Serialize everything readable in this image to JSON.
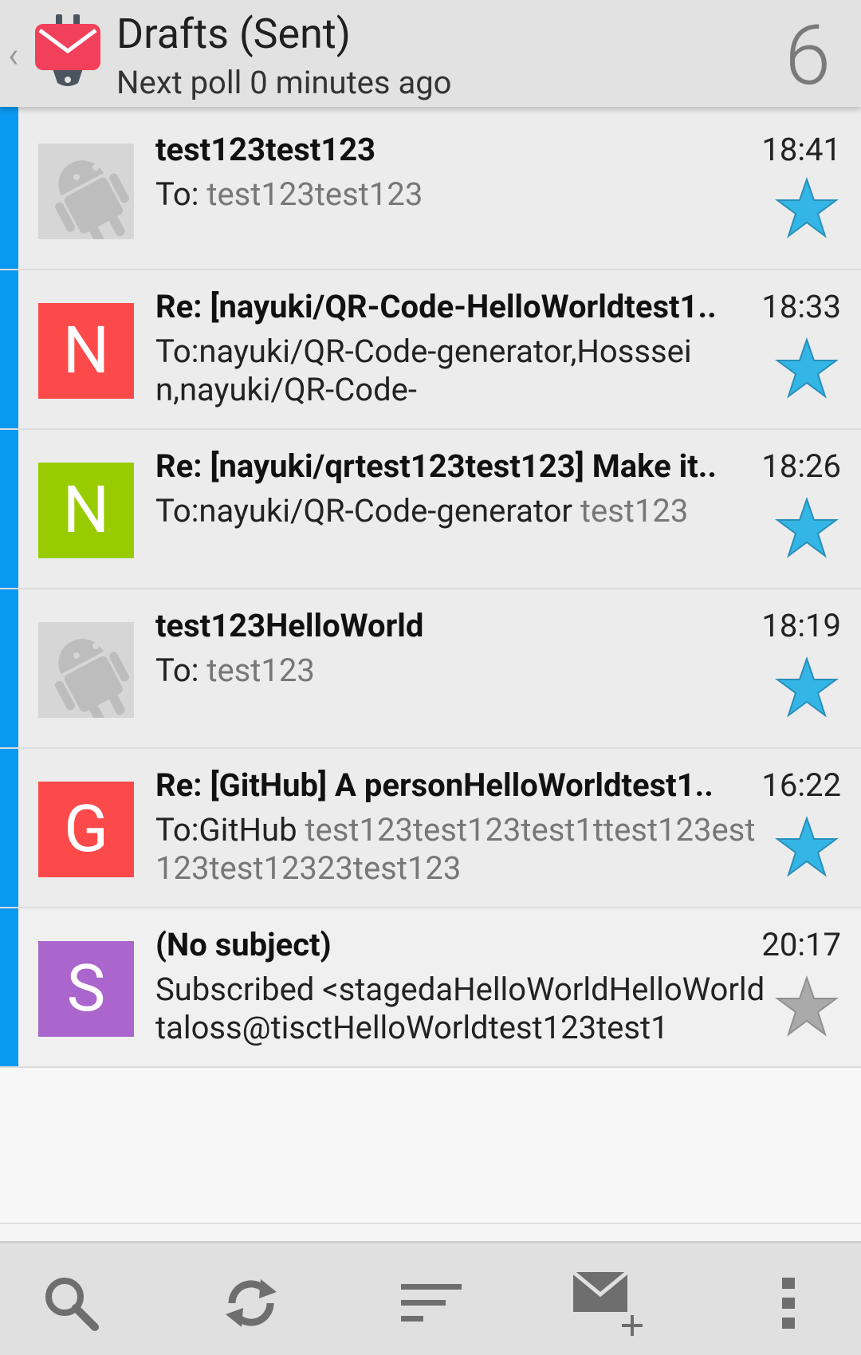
{
  "header": {
    "title": "Drafts (Sent)",
    "subtitle": "Next poll 0 minutes ago",
    "count": "6"
  },
  "messages": [
    {
      "subject": "test123test123",
      "time": "18:41",
      "to_prefix": "To: ",
      "to_grey": "test123test123",
      "avatar_letter": "",
      "avatar_color": "#d6d6d6",
      "starred": true
    },
    {
      "subject": "Re: [nayuki/QR-Code-HelloWorldtest1..",
      "time": "18:33",
      "to_prefix": "To:nayuki/QR-Code-generator,Hosssein,nayuki/QR-Code-",
      "to_grey": "",
      "avatar_letter": "N",
      "avatar_color": "#fc4a4a",
      "starred": true
    },
    {
      "subject": "Re: [nayuki/qrtest123test123] Make it..",
      "time": "18:26",
      "to_prefix": "To:nayuki/QR-Code-generator ",
      "to_grey": "test123",
      "avatar_letter": "N",
      "avatar_color": "#98cc00",
      "starred": true
    },
    {
      "subject": "test123HelloWorld",
      "time": "18:19",
      "to_prefix": "To: ",
      "to_grey": "test123",
      "avatar_letter": "",
      "avatar_color": "#d6d6d6",
      "starred": true
    },
    {
      "subject": "Re: [GitHub] A personHelloWorldtest1..",
      "time": "16:22",
      "to_prefix": "To:GitHub ",
      "to_grey": "test123test123test1ttest123est123test12323test123",
      "avatar_letter": "G",
      "avatar_color": "#fc4a4a",
      "starred": true
    },
    {
      "subject": "(No subject)",
      "time": "20:17",
      "to_prefix": "Subscribed <stagedaHelloWorldHelloWorldtaloss@tisctHelloWorldtest123test1",
      "to_grey": "",
      "avatar_letter": "S",
      "avatar_color": "#aa66cc",
      "starred": false
    }
  ],
  "colors": {
    "accent_bar": "#0a99f2",
    "star_on": "#33b5e5",
    "star_off": "#aaaaaa"
  },
  "toolbar": {
    "icons": [
      "search-icon",
      "refresh-icon",
      "sort-icon",
      "compose-icon",
      "overflow-menu-icon"
    ]
  }
}
